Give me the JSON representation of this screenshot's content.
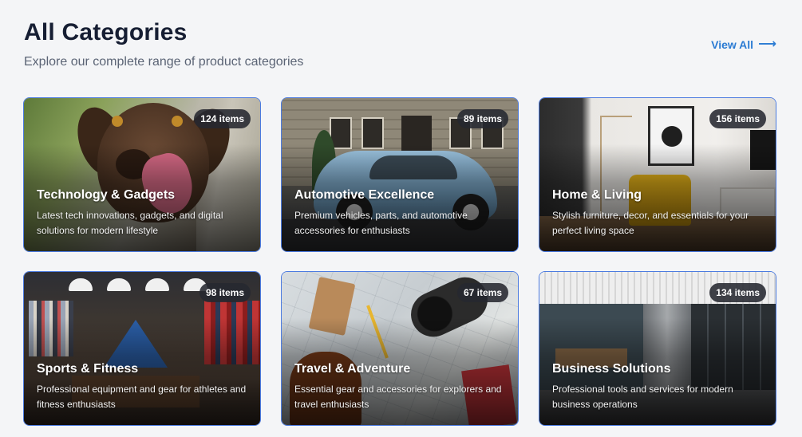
{
  "header": {
    "title": "All Categories",
    "subtitle": "Explore our complete range of product categories",
    "view_all_label": "View All",
    "view_all_icon": "arrow-right-icon"
  },
  "colors": {
    "accent": "#2b7bd3",
    "card_border": "#4c7be0",
    "title": "#161e33",
    "background": "#f4f5f7"
  },
  "categories": [
    {
      "title": "Technology & Gadgets",
      "count": "124 items",
      "description": "Latest tech innovations, gadgets, and digital solutions for modern lifestyle"
    },
    {
      "title": "Automotive Excellence",
      "count": "89 items",
      "description": "Premium vehicles, parts, and automotive accessories for enthusiasts"
    },
    {
      "title": "Home & Living",
      "count": "156 items",
      "description": "Stylish furniture, decor, and essentials for your perfect living space"
    },
    {
      "title": "Sports & Fitness",
      "count": "98 items",
      "description": "Professional equipment and gear for athletes and fitness enthusiasts"
    },
    {
      "title": "Travel & Adventure",
      "count": "67 items",
      "description": "Essential gear and accessories for explorers and travel enthusiasts"
    },
    {
      "title": "Business Solutions",
      "count": "134 items",
      "description": "Professional tools and services for modern business operations"
    }
  ]
}
